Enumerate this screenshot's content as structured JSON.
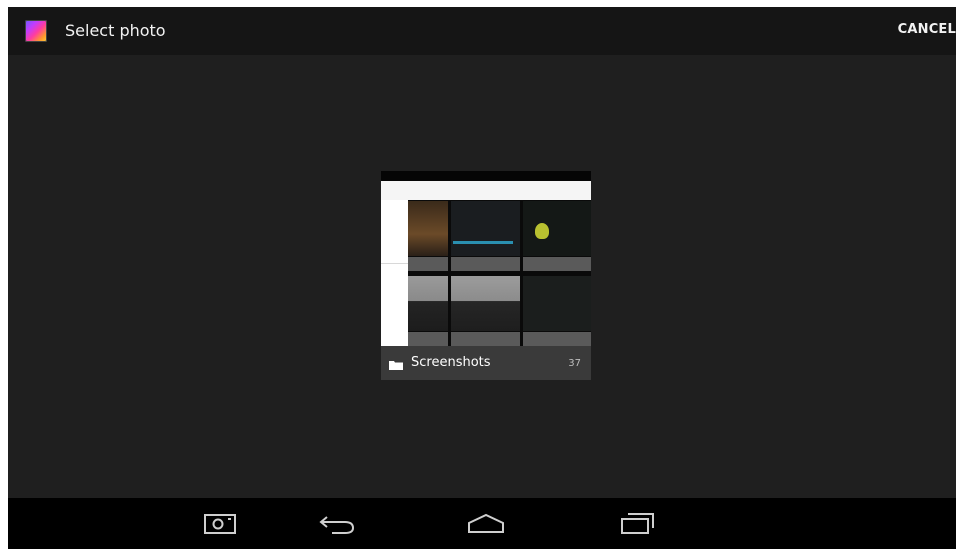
{
  "action_bar": {
    "title": "Select photo",
    "cancel_label": "CANCEL",
    "app_icon": "gallery-icon"
  },
  "album": {
    "name": "Screenshots",
    "count": "37",
    "icon": "folder-icon"
  },
  "nav_bar": {
    "buttons": [
      "camera-icon",
      "back-icon",
      "home-icon",
      "recent-apps-icon"
    ]
  }
}
